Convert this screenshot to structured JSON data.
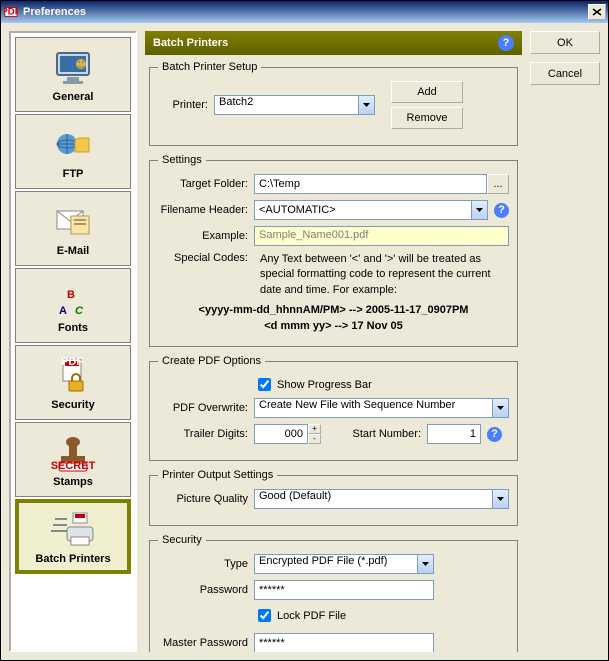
{
  "window": {
    "title": "Preferences"
  },
  "buttons": {
    "ok": "OK",
    "cancel": "Cancel",
    "close_x": "×"
  },
  "sidebar": {
    "items": [
      {
        "label": "General"
      },
      {
        "label": "FTP"
      },
      {
        "label": "E-Mail"
      },
      {
        "label": "Fonts"
      },
      {
        "label": "Security"
      },
      {
        "label": "Stamps"
      },
      {
        "label": "Batch Printers"
      }
    ],
    "selected_index": 6
  },
  "panel": {
    "title": "Batch Printers",
    "help": "?"
  },
  "batch_printer_setup": {
    "legend": "Batch Printer Setup",
    "printer_label": "Printer:",
    "printer_value": "Batch2",
    "add_btn": "Add",
    "remove_btn": "Remove"
  },
  "settings": {
    "legend": "Settings",
    "target_folder_label": "Target Folder:",
    "target_folder_value": "C:\\Temp",
    "filename_header_label": "Filename Header:",
    "filename_header_value": "<AUTOMATIC>",
    "example_label": "Example:",
    "example_value": "Sample_Name001.pdf",
    "special_codes_label": "Special Codes:",
    "special_codes_text": "Any Text between '<' and '>' will be treated as special formatting code to represent the current date and time. For example:",
    "example_line1": "<yyyy-mm-dd_hhnnAM/PM> --> 2005-11-17_0907PM",
    "example_line2": "<d mmm yy> --> 17 Nov 05"
  },
  "create_pdf": {
    "legend": "Create PDF Options",
    "show_progress_label": "Show Progress Bar",
    "show_progress_checked": true,
    "pdf_overwrite_label": "PDF Overwrite:",
    "pdf_overwrite_value": "Create New File with Sequence Number",
    "trailer_digits_label": "Trailer Digits:",
    "trailer_digits_value": "000",
    "start_number_label": "Start Number:",
    "start_number_value": "1"
  },
  "printer_output": {
    "legend": "Printer Output Settings",
    "picture_quality_label": "Picture Quality",
    "picture_quality_value": "Good (Default)"
  },
  "security": {
    "legend": "Security",
    "type_label": "Type",
    "type_value": "Encrypted PDF File (*.pdf)",
    "password_label": "Password",
    "password_value": "******",
    "lock_pdf_label": "Lock PDF File",
    "lock_pdf_checked": true,
    "master_password_label": "Master Password",
    "master_password_value": "******"
  }
}
